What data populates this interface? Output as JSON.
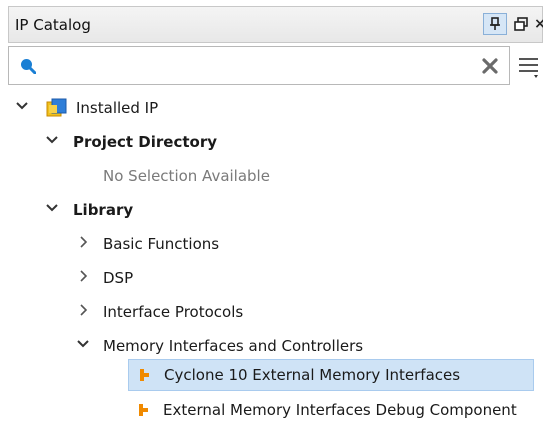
{
  "panel": {
    "title": "IP Catalog",
    "buttons": {
      "pin": "pin-icon",
      "float": "float-window-icon",
      "close": "×"
    }
  },
  "search": {
    "value": "",
    "placeholder": ""
  },
  "tree": {
    "installed_ip": "Installed IP",
    "project_directory": "Project Directory",
    "no_selection": "No Selection Available",
    "library": "Library",
    "basic_functions": "Basic Functions",
    "dsp": "DSP",
    "interface_protocols": "Interface Protocols",
    "memory_interfaces": "Memory Interfaces and Controllers",
    "item_cyclone": "Cyclone 10 External Memory Interfaces",
    "item_debug": "External Memory Interfaces Debug Component"
  },
  "colors": {
    "selection": "#cfe3f6",
    "ip_icon": "#f08a00",
    "search_icon": "#1a7fd4"
  }
}
